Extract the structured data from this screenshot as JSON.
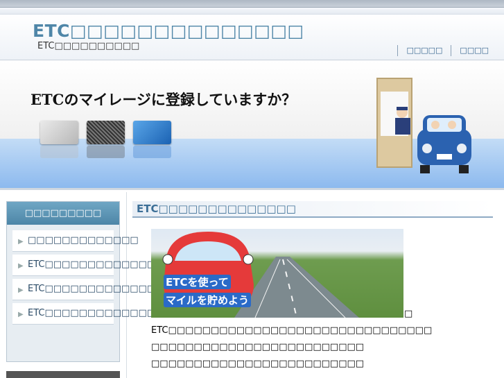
{
  "header": {
    "title": "ETC□□□□□□□□□□□□□□",
    "subtitle": "ETC□□□□□□□□□□",
    "nav": [
      "□□□□□",
      "□□□□"
    ]
  },
  "banner": {
    "headline": "ETCのマイレージに登録していますか？"
  },
  "sidebar": {
    "heading": "□□□□□□□□□",
    "items": [
      {
        "label": "□□□□□□□□□□□□□"
      },
      {
        "label": "ETC□□□□□□□□□□□□□□"
      },
      {
        "label": "ETC□□□□□□□□□□□□□□"
      },
      {
        "label": "ETC□□□□□□□□□□□□□□□□□□"
      }
    ]
  },
  "content": {
    "title": "ETC□□□□□□□□□□□□□□",
    "photo_caption_line1": "ETCを使って",
    "photo_caption_line2": "マイルを貯めよう",
    "photo_tail": "□",
    "paragraph": [
      "ETC□□□□□□□□□□□□□□□□□□□□□□□□□□□□□□□",
      "□□□□□□□□□□□□□□□□□□□□□□□□□",
      "□□□□□□□□□□□□□□□□□□□□□□□□□"
    ]
  },
  "colors": {
    "accent": "#4f86a8",
    "sidebar_head": "#5b93b4",
    "title_text": "#3b6e96"
  }
}
